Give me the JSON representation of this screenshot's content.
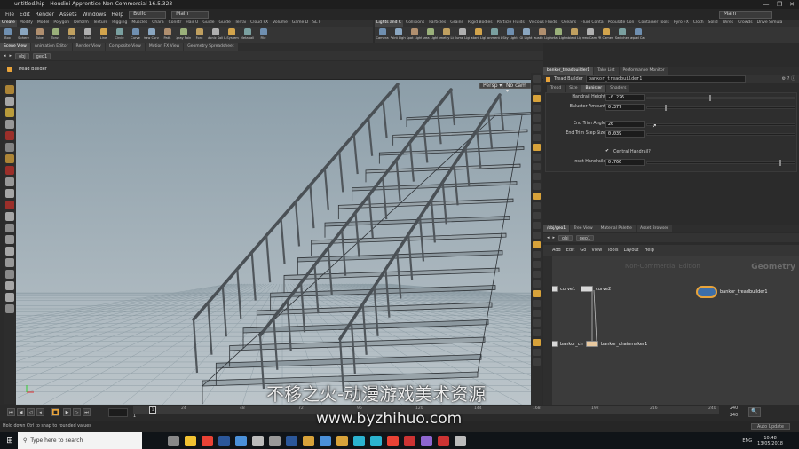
{
  "window": {
    "title": "untitled.hip - Houdini Apprentice Non-Commercial 16.5.323",
    "controls": [
      "—",
      "❐",
      "✕"
    ]
  },
  "menubar": {
    "items": [
      "File",
      "Edit",
      "Render",
      "Assets",
      "Windows",
      "Help"
    ],
    "desktop_select": "Build",
    "main_select": "Main",
    "right_main": "Main"
  },
  "shelf_tabs_left": [
    "Create",
    "Modify",
    "Model",
    "Polygon",
    "Deform",
    "Texture",
    "Rigging",
    "Muscles",
    "Chara",
    "Constr",
    "Hair U",
    "Guide",
    "Guide",
    "Terrai",
    "Cloud FX",
    "Volume",
    "Game D",
    "SL F"
  ],
  "shelf_tabs_right": [
    "Lights and C",
    "Collisions",
    "Particles",
    "Grains",
    "Rigid Bodies",
    "Particle Fluids",
    "Viscous Fluids",
    "Oceans",
    "Fluid Conta",
    "Populate Con",
    "Container Tools",
    "Pyro FX",
    "Cloth",
    "Solid",
    "Wires",
    "Crowds",
    "Drive Simula"
  ],
  "shelf_tools_left": [
    "Box",
    "Sphere",
    "Tube",
    "Torus",
    "Grid",
    "Null",
    "Line",
    "Circle",
    "Curve",
    "Draw Curve",
    "Path",
    "Spray Paint",
    "Font",
    "Platonic Solids",
    "L-System",
    "Metaball",
    "File"
  ],
  "shelf_tools_right": [
    "Camera",
    "Point Light",
    "Spot Light",
    "Area Light",
    "Geometry Light",
    "Volume Light",
    "Distant Light",
    "Environment Light",
    "Sky Light",
    "GI Light",
    "Caustic Light",
    "Portal Light",
    "Ambient Light",
    "Stereo Camera",
    "VR Camera",
    "Switcher",
    "Gamepad Camera"
  ],
  "viewport_tabs": [
    "Scene View",
    "Animation Editor",
    "Render View",
    "Composite View",
    "Motion FX View",
    "Geometry Spreadsheet"
  ],
  "viewport_path": {
    "label": "Tread Builder",
    "obj": "obj",
    "geo": "geo1"
  },
  "viewport_buttons": {
    "persp": "Persp ▾",
    "cam": "No cam ▾"
  },
  "param_tabs_top": [
    "bankor_treadbuilder1",
    "Take List",
    "Performance Monitor"
  ],
  "param_header": {
    "type": "Tread Builder",
    "name": "bankor_treadbuilder1"
  },
  "param_subtabs": [
    "Tread",
    "Size",
    "Banister",
    "Shaders"
  ],
  "params": [
    {
      "label": "Handrail Height",
      "value": "-0.226",
      "level": 0.42
    },
    {
      "label": "Baluster Amount",
      "value": "0.377",
      "level": 0.12
    },
    {
      "label": "End Trim Angle",
      "value": "26",
      "level": 0.0
    },
    {
      "label": "End Trim Step Size",
      "value": "0.039",
      "level": 0.0
    },
    {
      "label": "Inset Handrails",
      "value": "0.766",
      "level": 0.9
    }
  ],
  "toggle": {
    "label": "Central Handrail?",
    "checked": "✔"
  },
  "network_tabs": [
    "/obj/geo1",
    "Tree View",
    "Material Palette",
    "Asset Browser"
  ],
  "network_path": {
    "obj": "obj",
    "geo": "geo1"
  },
  "network_menu": [
    "Add",
    "Edit",
    "Go",
    "View",
    "Tools",
    "Layout",
    "Help"
  ],
  "network_watermark": "Non-Commercial Edition",
  "network_context": "Geometry",
  "nodes": [
    {
      "name": "curve1"
    },
    {
      "name": "curve2"
    },
    {
      "name": "bankor_treadbuilder1"
    },
    {
      "name": "bankor_ch"
    },
    {
      "name": "bankor_chainmaker1"
    }
  ],
  "timeline": {
    "frame": "1",
    "ticks": [
      "24",
      "48",
      "72",
      "96",
      "120",
      "144",
      "168",
      "192",
      "216",
      "240"
    ],
    "start": "1",
    "end": "240",
    "end2": "240",
    "range_start": "1",
    "auto_update": "Auto Update"
  },
  "status": "Hold down Ctrl to snap to rounded values",
  "taskbar": {
    "search": "Type here to search",
    "lang": "ENG",
    "time": "10:48",
    "date": "13/05/2018"
  },
  "watermarks": {
    "line1": "不移之火-动漫游戏美术资源",
    "line2": "www.byzhihuo.com"
  },
  "colors": {
    "accent": "#e8a33a",
    "viewport_top": "#8fa0ab",
    "viewport_bottom": "#b8c2c8",
    "taskbar": "#101418"
  }
}
